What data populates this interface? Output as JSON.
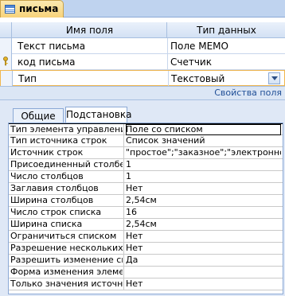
{
  "tab": {
    "title": "письма",
    "icon": "table-icon"
  },
  "grid": {
    "headers": {
      "name": "Имя поля",
      "type": "Тип данных"
    },
    "rows": [
      {
        "name": "Текст письма",
        "type": "Поле MEMO",
        "key": false
      },
      {
        "name": "код письма",
        "type": "Счетчик",
        "key": true
      },
      {
        "name": "Тип",
        "type": "Текстовый",
        "key": false,
        "current": true
      }
    ]
  },
  "props_title": "Свойства поля",
  "property_tabs": [
    {
      "label": "Общие"
    },
    {
      "label": "Подстановка",
      "active": true
    }
  ],
  "properties": [
    {
      "label": "Тип элемента управления",
      "value": "Поле со списком"
    },
    {
      "label": "Тип источника строк",
      "value": "Список значений"
    },
    {
      "label": "Источник строк",
      "value": "\"простое\";\"заказное\";\"электронное\""
    },
    {
      "label": "Присоединенный столбец",
      "value": "1"
    },
    {
      "label": "Число столбцов",
      "value": "1"
    },
    {
      "label": "Заглавия столбцов",
      "value": "Нет"
    },
    {
      "label": "Ширина столбцов",
      "value": "2,54см"
    },
    {
      "label": "Число строк списка",
      "value": "16"
    },
    {
      "label": "Ширина списка",
      "value": "2,54см"
    },
    {
      "label": "Ограничиться списком",
      "value": "Нет"
    },
    {
      "label": "Разрешение нескольких значений",
      "value": "Нет"
    },
    {
      "label": "Разрешить изменение списка значений",
      "value": "Да"
    },
    {
      "label": "Форма изменения элементов списка",
      "value": ""
    },
    {
      "label": "Только значения источника строк",
      "value": "Нет"
    }
  ]
}
